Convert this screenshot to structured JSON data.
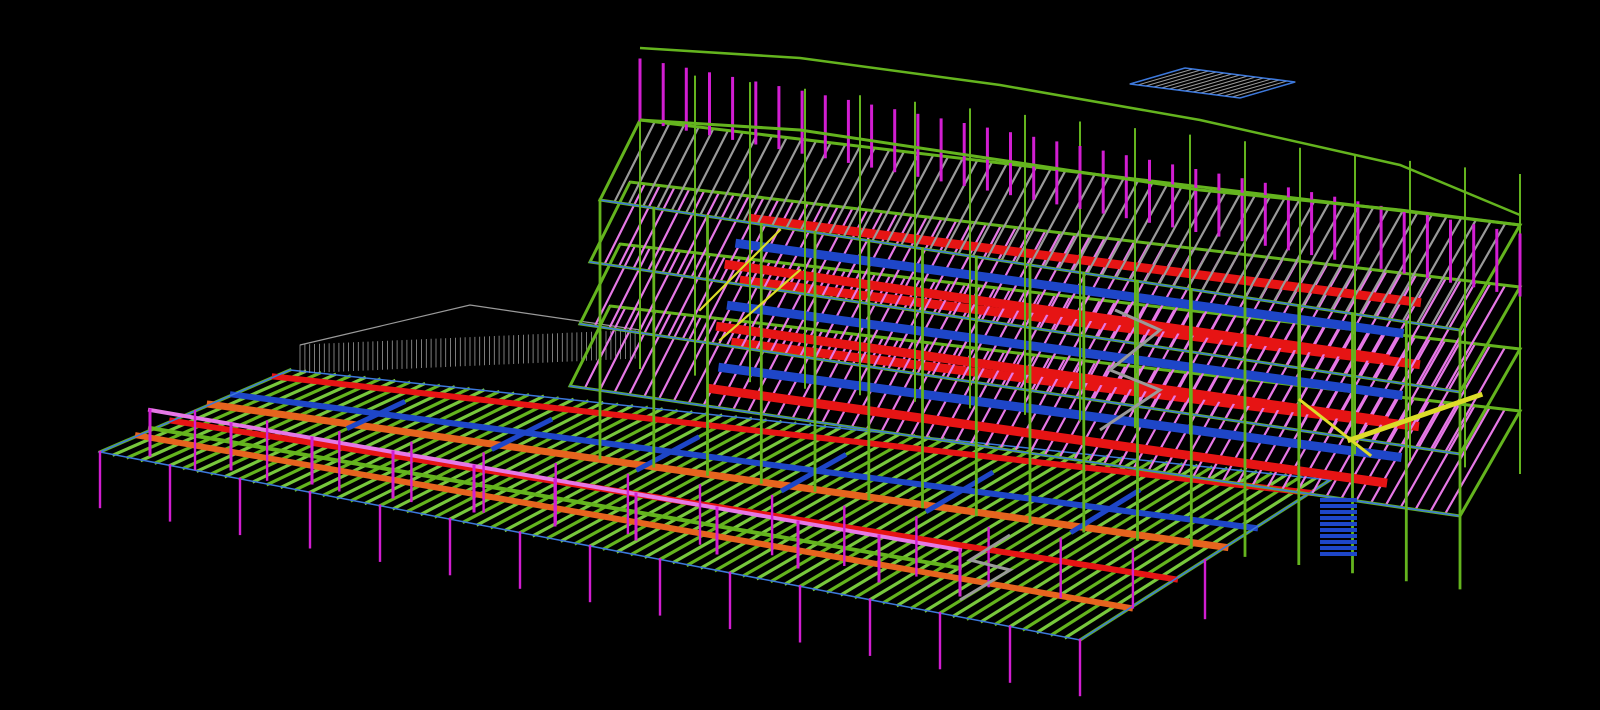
{
  "viewport": {
    "background": "#000000",
    "projection": "isometric"
  },
  "model": {
    "kind": "structural steel framing wireframe",
    "blocks": [
      {
        "name": "low-wing",
        "storeys": 1
      },
      {
        "name": "tower",
        "storeys": 5
      }
    ],
    "member_colors": {
      "columns": "#d21ed2",
      "primary_beams": "#64b41e",
      "secondary_beams": "#78c83c",
      "girders_red": "#e61414",
      "girders_blue": "#1e46c8",
      "girders_orange": "#e6641e",
      "deck_edge": "#3c78dc",
      "railings": "#9a9a9a",
      "bracing": "#dcdc28",
      "slab_joists": "#e678e6"
    }
  }
}
